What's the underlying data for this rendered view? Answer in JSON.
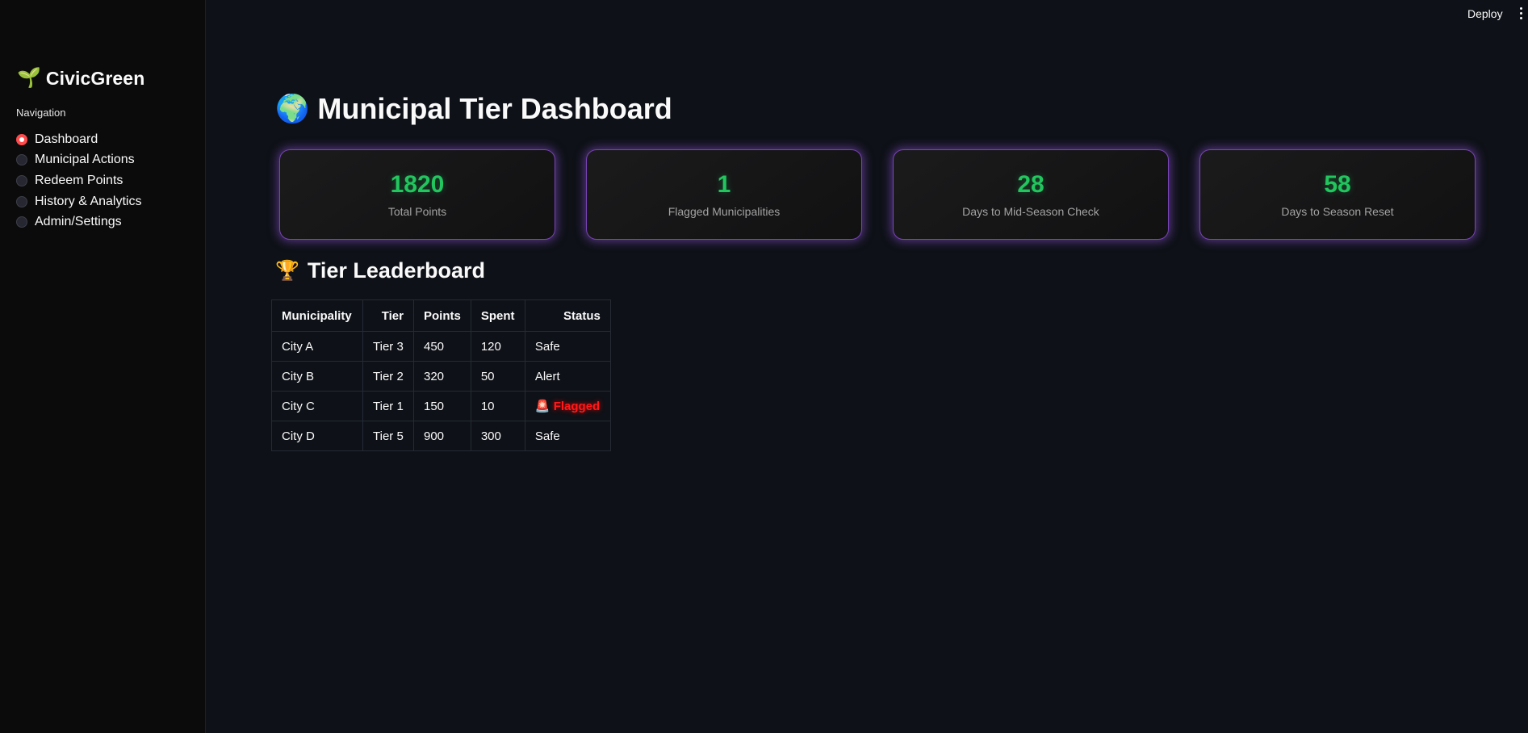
{
  "header": {
    "deploy_label": "Deploy"
  },
  "sidebar": {
    "logo_emoji": "🌱",
    "brand": "CivicGreen",
    "nav_label": "Navigation",
    "items": [
      {
        "label": "Dashboard",
        "selected": true
      },
      {
        "label": "Municipal Actions",
        "selected": false
      },
      {
        "label": "Redeem Points",
        "selected": false
      },
      {
        "label": "History & Analytics",
        "selected": false
      },
      {
        "label": "Admin/Settings",
        "selected": false
      }
    ]
  },
  "main": {
    "title_emoji": "🌍",
    "title": "Municipal Tier Dashboard",
    "metrics": [
      {
        "value": "1820",
        "label": "Total Points"
      },
      {
        "value": "1",
        "label": "Flagged Municipalities"
      },
      {
        "value": "28",
        "label": "Days to Mid-Season Check"
      },
      {
        "value": "58",
        "label": "Days to Season Reset"
      }
    ],
    "leaderboard_emoji": "🏆",
    "leaderboard_title": "Tier Leaderboard",
    "table": {
      "columns": [
        "Municipality",
        "Tier",
        "Points",
        "Spent",
        "Status"
      ],
      "rows": [
        {
          "municipality": "City A",
          "tier": "Tier 3",
          "points": "450",
          "spent": "120",
          "status": "Safe"
        },
        {
          "municipality": "City B",
          "tier": "Tier 2",
          "points": "320",
          "spent": "50",
          "status": "Alert"
        },
        {
          "municipality": "City C",
          "tier": "Tier 1",
          "points": "150",
          "spent": "10",
          "status_emoji": "🚨",
          "status": "Flagged"
        },
        {
          "municipality": "City D",
          "tier": "Tier 5",
          "points": "900",
          "spent": "300",
          "status": "Safe"
        }
      ]
    }
  },
  "colors": {
    "background": "#0e1117",
    "sidebar": "#0b0b0b",
    "metric_value": "#22c55e",
    "metric_glow": "#9254de",
    "radio_selected": "#ff4b4b",
    "flagged": "#ff1a1a"
  }
}
